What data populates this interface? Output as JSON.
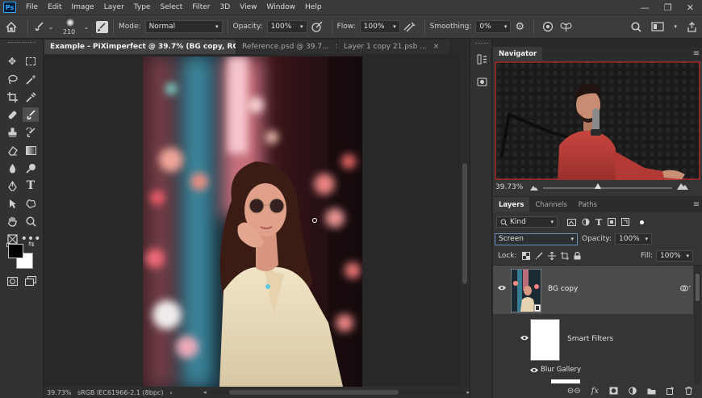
{
  "menubar": {
    "logo": "Ps",
    "items": [
      "File",
      "Edit",
      "Image",
      "Layer",
      "Type",
      "Select",
      "Filter",
      "3D",
      "View",
      "Window",
      "Help"
    ],
    "window_controls": [
      "—",
      "❐",
      "✕"
    ]
  },
  "options": {
    "brush_size": "210",
    "mode_label": "Mode:",
    "mode_value": "Normal",
    "opacity_label": "Opacity:",
    "opacity_value": "100%",
    "flow_label": "Flow:",
    "flow_value": "100%",
    "smoothing_label": "Smoothing:",
    "smoothing_value": "0%"
  },
  "tabs": [
    {
      "label": "Example - PiXimperfect @ 39.7% (BG copy, RGB/8) *",
      "active": true
    },
    {
      "label": "Reference.psd @ 39.7...",
      "active": false
    },
    {
      "label": "Layer 1 copy 21.psb ...",
      "active": false
    }
  ],
  "status": {
    "zoom": "39.73%",
    "profile": "sRGB IEC61966-2.1 (8bpc)"
  },
  "navigator": {
    "title": "Navigator",
    "zoom": "39.73%"
  },
  "layers_panel": {
    "tabs": [
      "Layers",
      "Channels",
      "Paths"
    ],
    "filter_kind": "Kind",
    "blend_mode": "Screen",
    "opacity_label": "Opacity:",
    "opacity_value": "100%",
    "lock_label": "Lock:",
    "fill_label": "Fill:",
    "fill_value": "100%",
    "layers": [
      {
        "name": "BG copy"
      },
      {
        "name": "Smart Filters"
      },
      {
        "name": "Blur Gallery"
      }
    ]
  },
  "colors": {
    "accent": "#31a8ff",
    "selected_layer": "#4b4b4b"
  }
}
